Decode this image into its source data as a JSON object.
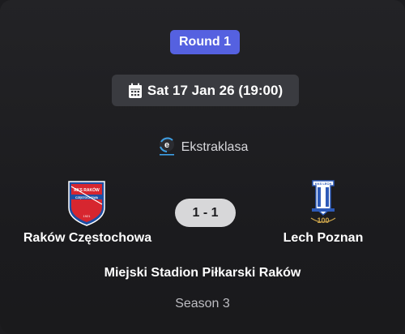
{
  "match": {
    "round_label": "Round 1",
    "datetime": "Sat 17 Jan 26 (19:00)",
    "league": {
      "name": "Ekstraklasa",
      "icon": "ekstraklasa-logo"
    },
    "home_team": {
      "name": "Raków Częstochowa",
      "crest": "rakow-crest",
      "crest_text": "RKS RAKÓW CZĘSTOCHOWA"
    },
    "away_team": {
      "name": "Lech Poznan",
      "crest": "lech-crest",
      "crest_text": "100"
    },
    "score": "1 - 1",
    "venue": "Miejski Stadion Piłkarski Raków",
    "season": "Season 3"
  },
  "colors": {
    "background": "#1c1c1f",
    "round_badge": "#5561e0",
    "date_pill": "#3a3b40",
    "score_pill": "#d7d7d9",
    "home_red": "#d7262f",
    "home_blue": "#1d4fa3",
    "away_blue": "#2d5ab8"
  }
}
